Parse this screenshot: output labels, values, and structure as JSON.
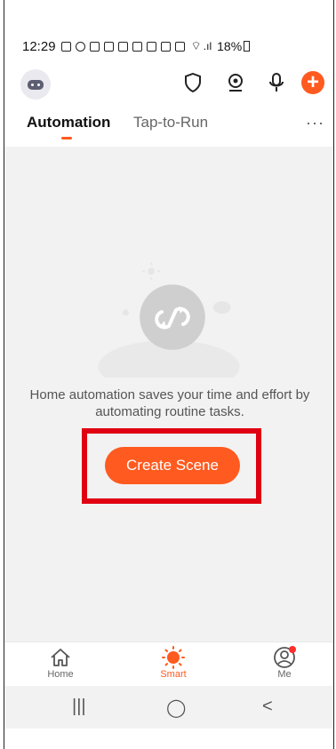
{
  "status_bar": {
    "time": "12:29",
    "battery": "18%"
  },
  "header": {
    "icons": [
      "robot-avatar",
      "shield-icon",
      "camera-icon",
      "mic-icon",
      "plus-icon"
    ]
  },
  "tabs": {
    "active": "Automation",
    "inactive": "Tap-to-Run",
    "more": "···"
  },
  "main": {
    "description": "Home automation saves your time and effort by automating routine tasks.",
    "create_button": "Create Scene"
  },
  "bottom_nav": {
    "items": [
      {
        "label": "Home",
        "icon": "home-icon"
      },
      {
        "label": "Smart",
        "icon": "sun-icon"
      },
      {
        "label": "Me",
        "icon": "profile-icon"
      }
    ]
  },
  "system_nav": {
    "recents": "|||",
    "home": "◯",
    "back": "<"
  },
  "colors": {
    "accent": "#ff5a1f",
    "highlight": "#e00012"
  }
}
